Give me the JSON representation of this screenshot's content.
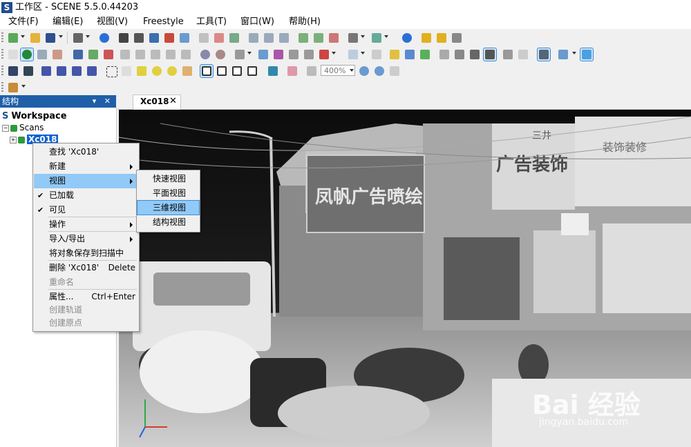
{
  "window": {
    "app_logo": "S",
    "title": "工作区 - SCENE 5.5.0.44203"
  },
  "menu": {
    "file": "文件(F)",
    "edit": "编辑(E)",
    "view": "视图(V)",
    "freestyle": "Freestyle",
    "tools": "工具(T)",
    "window": "窗口(W)",
    "help": "帮助(H)"
  },
  "toolbar": {
    "zoom_value": "400%"
  },
  "structure_panel": {
    "title": "结构",
    "controls": "▾ ✕",
    "workspace_icon": "S",
    "workspace_label": "Workspace",
    "scans_label": "Scans",
    "scan_item_label": "Xc018"
  },
  "document_tab": {
    "label": "Xc018",
    "close": "✕"
  },
  "context_menu": {
    "find": "查找 'Xc018'",
    "new": "新建",
    "view": "视图",
    "loaded": "已加载",
    "visible": "可见",
    "operations": "操作",
    "import_export": "导入/导出",
    "save_to_scan": "将对象保存到扫描中",
    "delete": "删除 'Xc018'",
    "delete_shortcut": "Delete",
    "rename": "重命名",
    "properties": "属性...",
    "properties_shortcut": "Ctrl+Enter",
    "create_track": "创建轨道",
    "create_origin": "创建原点",
    "checkmark": "✔"
  },
  "view_submenu": {
    "quick_view": "快速视图",
    "planar_view": "平面视图",
    "view_3d": "三维视图",
    "structure_view": "结构视图"
  },
  "viewport_scene": {
    "sign_left": "凤帆广告喷绘",
    "sign_right": "广告装饰",
    "sign_right_top": "三井",
    "sign_far_right": "装饰装修"
  },
  "watermark": {
    "brand": "Bai 经验",
    "url": "jingyan.baidu.com"
  }
}
